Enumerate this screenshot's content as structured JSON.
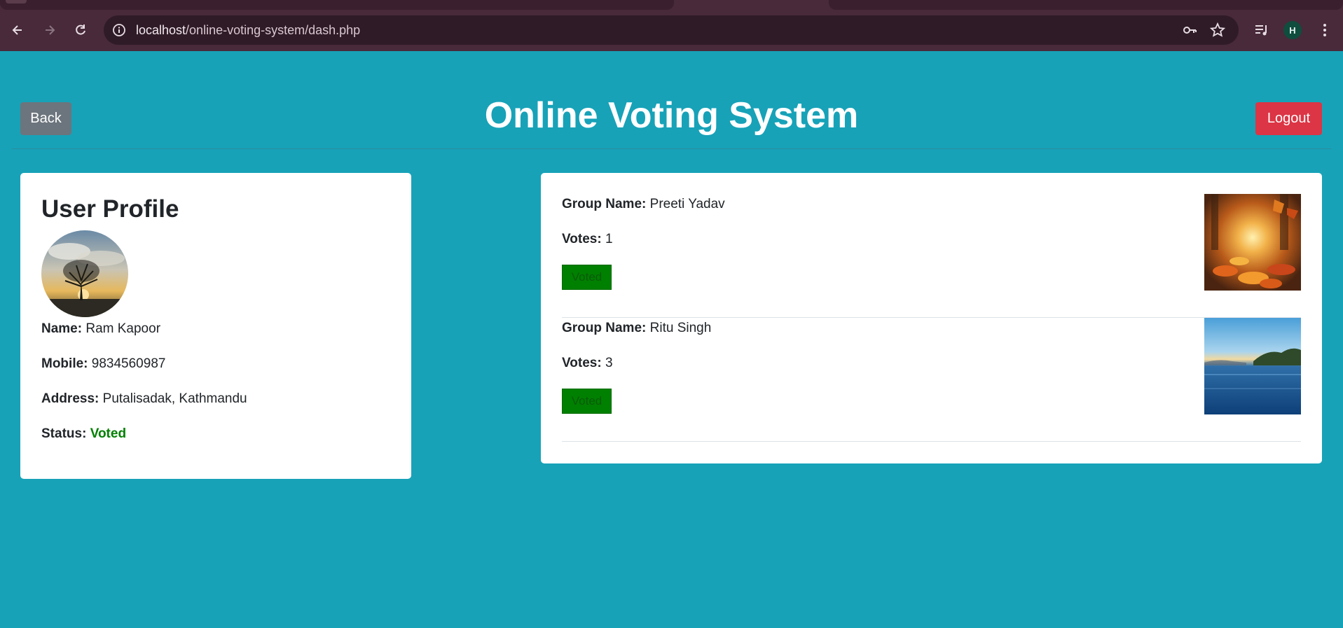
{
  "browser": {
    "url_host": "localhost",
    "url_path": "/online-voting-system/dash.php",
    "profile_initial": "H"
  },
  "header": {
    "back_label": "Back",
    "title": "Online Voting System",
    "logout_label": "Logout"
  },
  "profile": {
    "heading": "User Profile",
    "name_label": "Name:",
    "name": "Ram Kapoor",
    "mobile_label": "Mobile:",
    "mobile": "9834560987",
    "address_label": "Address:",
    "address": "Putalisadak, Kathmandu",
    "status_label": "Status:",
    "status": "Voted",
    "status_color": "#008000"
  },
  "groups": [
    {
      "name_label": "Group Name:",
      "name": "Preeti Yadav",
      "votes_label": "Votes:",
      "votes": "1",
      "button_label": "Voted"
    },
    {
      "name_label": "Group Name:",
      "name": "Ritu Singh",
      "votes_label": "Votes:",
      "votes": "3",
      "button_label": "Voted"
    }
  ],
  "colors": {
    "page_bg": "#17a2b8",
    "back_button": "#6c757d",
    "logout_button": "#dc3545",
    "voted_button": "#008000"
  }
}
